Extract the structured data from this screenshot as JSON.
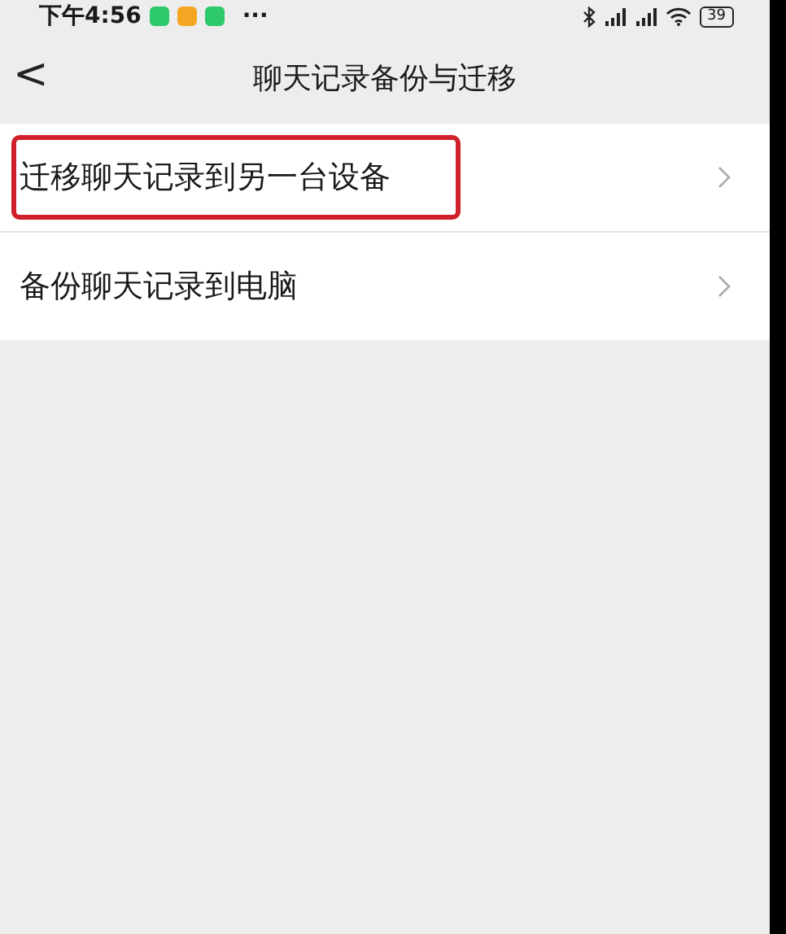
{
  "status_bar": {
    "time": "下午4:56",
    "app_icons": [
      {
        "color": "#2ec96a"
      },
      {
        "color": "#f5a623"
      },
      {
        "color": "#2ec96a"
      }
    ],
    "more": "···",
    "battery": "39"
  },
  "nav_bar": {
    "back": "<",
    "title": "聊天记录备份与迁移"
  },
  "items": [
    {
      "label": "迁移聊天记录到另一台设备",
      "highlighted": true
    },
    {
      "label": "备份聊天记录到电脑",
      "highlighted": false
    }
  ]
}
